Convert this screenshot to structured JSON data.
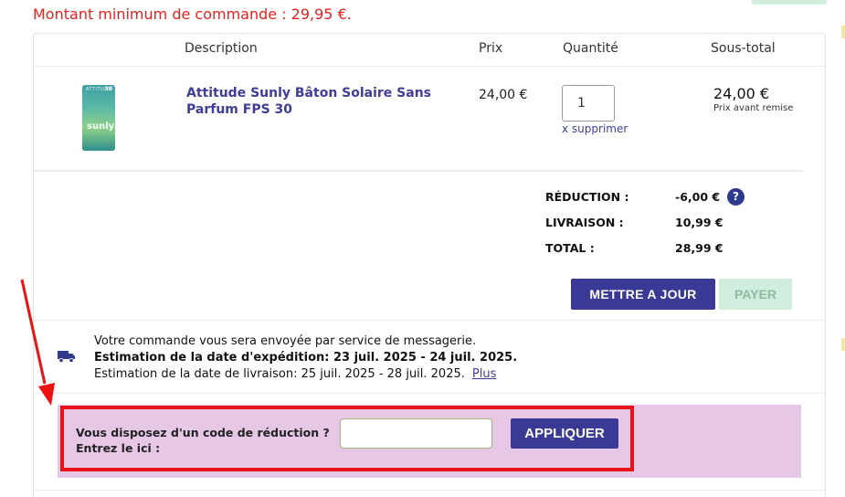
{
  "notice": {
    "min_order": "Montant minimum de commande : 29,95 €."
  },
  "table": {
    "headers": {
      "description": "Description",
      "price": "Prix",
      "quantity": "Quantité",
      "subtotal": "Sous-total"
    }
  },
  "item": {
    "image_brand": "ATTITUDE",
    "image_fps": "30",
    "image_word": "sunly",
    "name": "Attitude Sunly Bâton Solaire Sans Parfum FPS 30",
    "price": "24,00 €",
    "quantity": "1",
    "remove_label": "x supprimer",
    "subtotal": "24,00 €",
    "subtotal_note": "Prix avant remise"
  },
  "summary": {
    "discount_label": "RÉDUCTION :",
    "discount_value": "-6,00 €",
    "help_glyph": "?",
    "shipping_label": "LIVRAISON :",
    "shipping_value": "10,99 €",
    "total_label": "TOTAL :",
    "total_value": "28,99 €"
  },
  "actions": {
    "update_label": "METTRE A JOUR",
    "pay_label": "PAYER"
  },
  "shipping": {
    "line1": "Votre commande vous sera envoyée par service de messagerie.",
    "line2": "Estimation de la date d'expédition: 23 juil. 2025 - 24 juil. 2025.",
    "line3": "Estimation de la date de livraison: 25 juil. 2025 - 28 juil. 2025.",
    "more_link": "Plus"
  },
  "promo": {
    "line1": "Vous disposez d'un code de réduction ?",
    "line2": "Entrez le ici :",
    "input_value": "",
    "apply_label": "APPLIQUER"
  },
  "colors": {
    "accent": "#3a3a96",
    "pay_disabled": "#cfeedd",
    "promo_band": "#e6c8e6",
    "alert_red": "#e8211d"
  },
  "icons": {
    "truck": "truck-icon",
    "help": "help-icon"
  }
}
